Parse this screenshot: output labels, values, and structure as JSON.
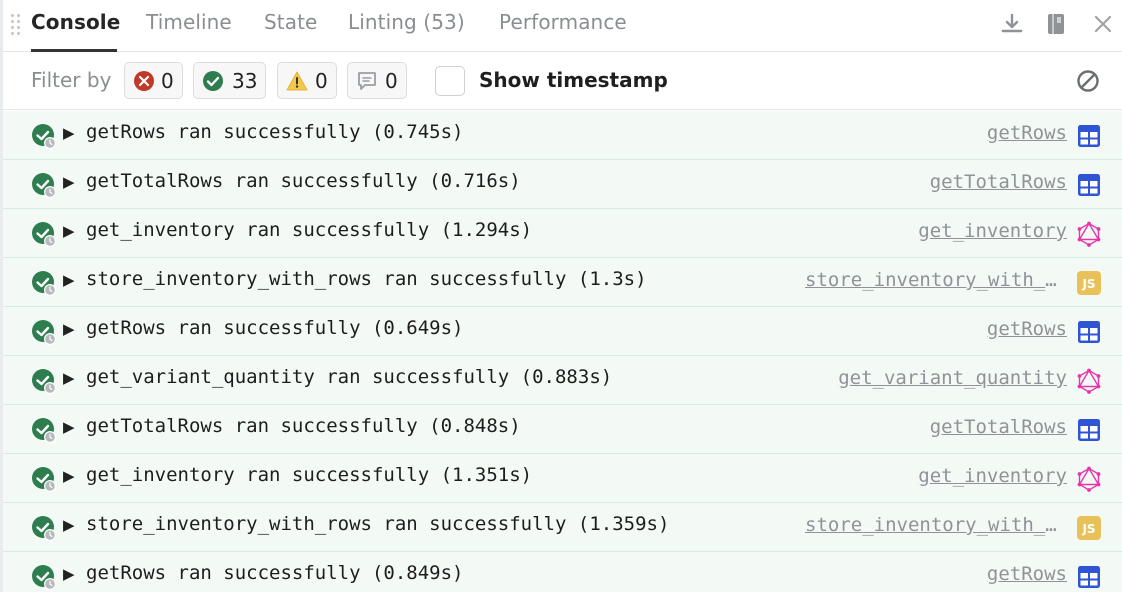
{
  "tabs": [
    {
      "label": "Console",
      "active": true
    },
    {
      "label": "Timeline",
      "active": false
    },
    {
      "label": "State",
      "active": false
    },
    {
      "label": "Linting (53)",
      "active": false
    },
    {
      "label": "Performance",
      "active": false
    }
  ],
  "toolbar_icons": [
    "download-icon",
    "book-icon",
    "close-icon"
  ],
  "filter": {
    "label": "Filter by",
    "error_count": "0",
    "success_count": "33",
    "warning_count": "0",
    "info_count": "0",
    "show_timestamp_label": "Show timestamp",
    "show_timestamp_checked": false
  },
  "colors": {
    "success": "#2e7d4f",
    "error": "#c0392b",
    "warning": "#f2c94c",
    "table_icon": "#2f55d4",
    "graphql_icon": "#e535ab",
    "js_icon": "#e8c15a",
    "row_bg": "#f3faf6"
  },
  "log": [
    {
      "message": "getRows ran successfully (0.745s)",
      "source": "getRows",
      "type": "table"
    },
    {
      "message": "getTotalRows ran successfully (0.716s)",
      "source": "getTotalRows",
      "type": "table"
    },
    {
      "message": "get_inventory ran successfully (1.294s)",
      "source": "get_inventory",
      "type": "graphql"
    },
    {
      "message": "store_inventory_with_rows ran successfully (1.3s)",
      "source": "store_inventory_with_rows",
      "type": "js"
    },
    {
      "message": "getRows ran successfully (0.649s)",
      "source": "getRows",
      "type": "table"
    },
    {
      "message": "get_variant_quantity ran successfully (0.883s)",
      "source": "get_variant_quantity",
      "type": "graphql"
    },
    {
      "message": "getTotalRows ran successfully (0.848s)",
      "source": "getTotalRows",
      "type": "table"
    },
    {
      "message": "get_inventory ran successfully (1.351s)",
      "source": "get_inventory",
      "type": "graphql"
    },
    {
      "message": "store_inventory_with_rows ran successfully (1.359s)",
      "source": "store_inventory_with_rows",
      "type": "js"
    },
    {
      "message": "getRows ran successfully (0.849s)",
      "source": "getRows",
      "type": "table"
    }
  ],
  "js_badge_label": "JS"
}
